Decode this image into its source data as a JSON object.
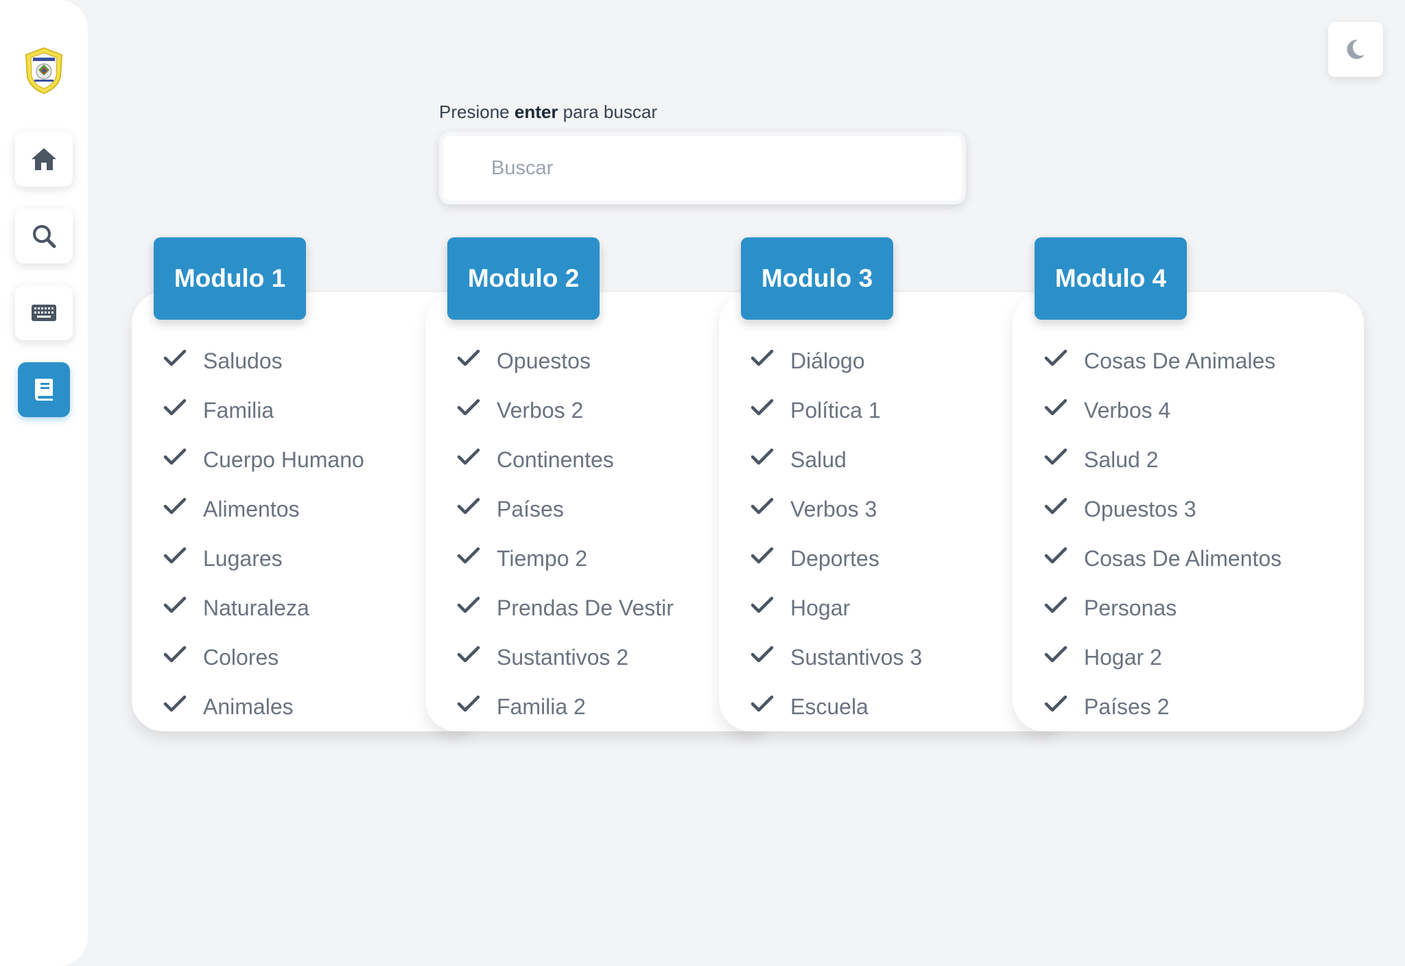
{
  "sidebar": {
    "logo": "school-shield-logo",
    "items": [
      {
        "name": "home",
        "icon": "home-icon"
      },
      {
        "name": "search",
        "icon": "search-icon"
      },
      {
        "name": "keyboard",
        "icon": "keyboard-icon"
      },
      {
        "name": "book",
        "icon": "book-icon",
        "active": true
      }
    ]
  },
  "theme_toggle": {
    "icon": "moon-icon"
  },
  "search": {
    "hint_prefix": "Presione",
    "hint_bold": "enter",
    "hint_suffix": "para buscar",
    "placeholder": "Buscar",
    "value": ""
  },
  "colors": {
    "accent": "#2b90c9",
    "text": "#6b7280",
    "background": "#f3f4f6"
  },
  "modules": [
    {
      "title": "Modulo 1",
      "topics": [
        "Saludos",
        "Familia",
        "Cuerpo Humano",
        "Alimentos",
        "Lugares",
        "Naturaleza",
        "Colores",
        "Animales"
      ]
    },
    {
      "title": "Modulo 2",
      "topics": [
        "Opuestos",
        "Verbos 2",
        "Continentes",
        "Países",
        "Tiempo 2",
        "Prendas De Vestir",
        "Sustantivos 2",
        "Familia 2"
      ]
    },
    {
      "title": "Modulo 3",
      "topics": [
        "Diálogo",
        "Política 1",
        "Salud",
        "Verbos 3",
        "Deportes",
        "Hogar",
        "Sustantivos 3",
        "Escuela"
      ]
    },
    {
      "title": "Modulo 4",
      "topics": [
        "Cosas De Animales",
        "Verbos 4",
        "Salud 2",
        "Opuestos 3",
        "Cosas De Alimentos",
        "Personas",
        "Hogar 2",
        "Países 2"
      ]
    }
  ]
}
